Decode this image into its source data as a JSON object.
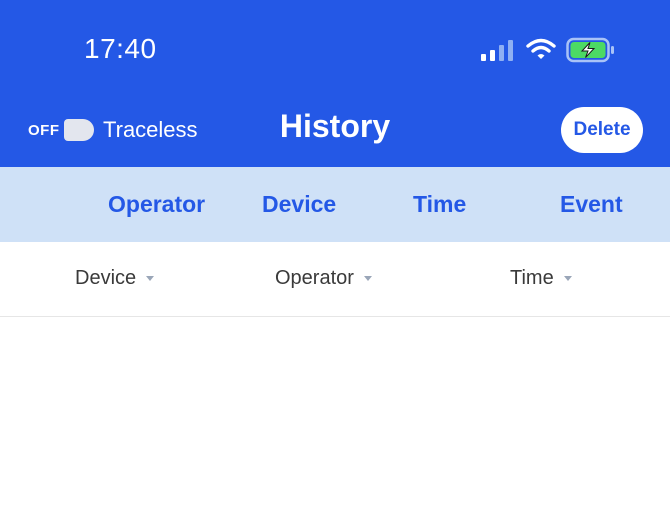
{
  "status_bar": {
    "time": "17:40",
    "icons": [
      "cellular-signal-icon",
      "wifi-icon",
      "battery-charging-icon"
    ]
  },
  "header": {
    "toggle_state": "OFF",
    "toggle_label": "Traceless",
    "title": "History",
    "delete_label": "Delete"
  },
  "tabs": [
    {
      "label": "Operator"
    },
    {
      "label": "Device"
    },
    {
      "label": "Time"
    },
    {
      "label": "Event"
    }
  ],
  "filters": [
    {
      "label": "Device"
    },
    {
      "label": "Operator"
    },
    {
      "label": "Time"
    }
  ],
  "colors": {
    "brand_blue": "#2458e6",
    "tab_background": "#cfe1f7",
    "battery_fill": "#4cd964"
  }
}
